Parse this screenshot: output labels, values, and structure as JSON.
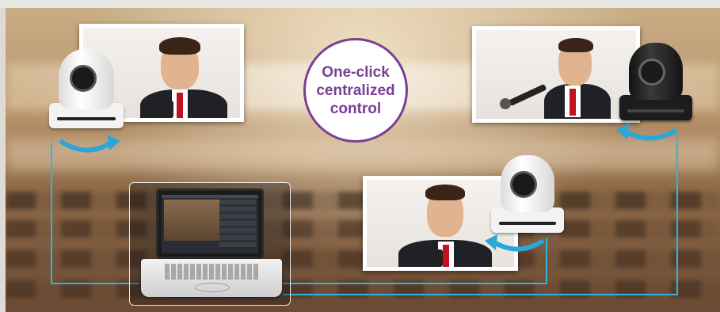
{
  "badge": {
    "text": "One-click\ncentralized\ncontrol"
  },
  "colors": {
    "badge_accent": "#7a3f95",
    "arrow": "#2aa6d8",
    "wire": "#32b4e0"
  },
  "cameras": [
    {
      "name": "camera-white-left",
      "color": "white"
    },
    {
      "name": "camera-black-right",
      "color": "black"
    },
    {
      "name": "camera-white-center",
      "color": "white"
    }
  ],
  "icons": [
    "ptz-camera-icon",
    "rotate-arrow-icon",
    "laptop-icon"
  ]
}
